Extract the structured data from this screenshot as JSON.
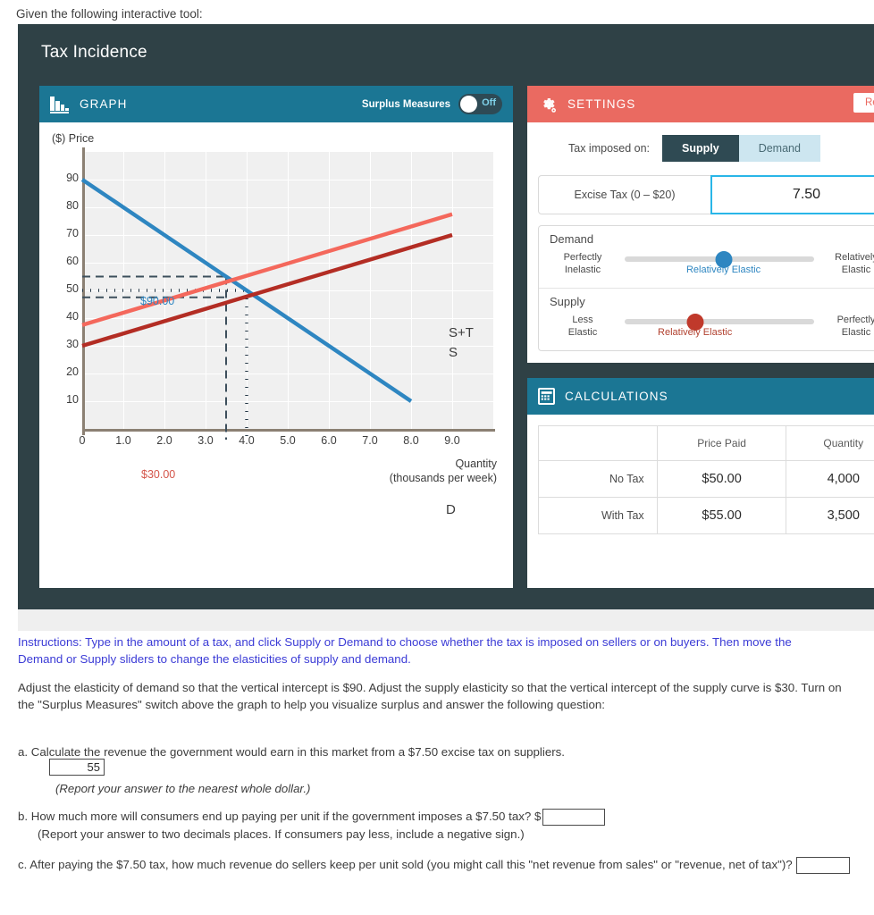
{
  "intro": "Given the following interactive tool:",
  "tool": {
    "title": "Tax Incidence",
    "graph_panel": {
      "header_label": "GRAPH",
      "icon": "bar-chart-icon",
      "switch": {
        "label": "Surplus Measures",
        "state": "Off"
      }
    },
    "settings_panel": {
      "header_label": "SETTINGS",
      "icon": "gear-icon",
      "reset_label": "Reset",
      "tax_imposed_on_label": "Tax imposed on:",
      "segments": [
        {
          "label": "Supply",
          "selected": true
        },
        {
          "label": "Demand",
          "selected": false
        }
      ],
      "excise": {
        "label": "Excise Tax (0 – $20)",
        "value": "7.50"
      },
      "demand": {
        "title": "Demand",
        "left_label": "Perfectly\nInelastic",
        "right_label": "Relatively\nElastic",
        "caption": "Relatively Elastic",
        "position_pct": 52,
        "color": "#2e86c1"
      },
      "supply": {
        "title": "Supply",
        "left_label": "Less\nElastic",
        "right_label": "Perfectly\nElastic",
        "caption": "Relatively Elastic",
        "position_pct": 38,
        "color": "#c0392b"
      }
    },
    "calculations_panel": {
      "header_label": "CALCULATIONS",
      "icon": "calculator-icon",
      "columns": [
        "",
        "Price Paid",
        "Quantity"
      ],
      "rows": [
        {
          "label": "No Tax",
          "price_paid": "$50.00",
          "quantity": "4,000"
        },
        {
          "label": "With Tax",
          "price_paid": "$55.00",
          "quantity": "3,500"
        }
      ]
    }
  },
  "chart_data": {
    "type": "line",
    "title": "",
    "ylabel": "($) Price",
    "xlabel": "Quantity\n(thousands per week)",
    "xlabel_line1": "Quantity",
    "xlabel_line2": "(thousands per week)",
    "xlim": [
      0,
      10
    ],
    "ylim": [
      0,
      100
    ],
    "yticks": [
      90,
      80,
      70,
      60,
      50,
      40,
      30,
      20,
      10
    ],
    "xticks": [
      "0",
      "1.0",
      "2.0",
      "3.0",
      "4.0",
      "5.0",
      "6.0",
      "7.0",
      "8.0",
      "9.0"
    ],
    "grid": true,
    "legend": "inline-labels",
    "series": [
      {
        "name": "D",
        "label": "D",
        "color": "#2e86c1",
        "points": [
          [
            0,
            90
          ],
          [
            8,
            10
          ]
        ],
        "annotation": "$90.00",
        "annotation_value": 90
      },
      {
        "name": "S",
        "label": "S",
        "color": "#b32d24",
        "points": [
          [
            0,
            30
          ],
          [
            9,
            70
          ]
        ],
        "annotation": "$30.00",
        "annotation_value": 30
      },
      {
        "name": "S+T",
        "label": "S+T",
        "color": "#f4685c",
        "points": [
          [
            0,
            37.5
          ],
          [
            9,
            77.5
          ]
        ]
      }
    ],
    "markers": {
      "dotted_equilibrium": {
        "price": 50,
        "quantity": 4.0,
        "style": "dotted"
      },
      "dashed_with_tax_buyer": {
        "price": 55,
        "quantity": 3.5,
        "style": "dashed"
      },
      "dashed_with_tax_seller": {
        "price": 47.5,
        "quantity": 3.5,
        "style": "dashed"
      }
    }
  },
  "body": {
    "instructions": "Instructions: Type in the amount of a tax, and click Supply or Demand to choose whether the tax is imposed on sellers or on buyers.  Then move the Demand or Supply sliders to change the elasticities of supply and demand.",
    "paragraph": "Adjust the elasticity of demand so that the vertical intercept is $90.  Adjust the supply elasticity so that the vertical intercept of the supply curve is $30.  Turn on the \"Surplus Measures\" switch above the graph to help you visualize surplus and answer the following question:",
    "question_a": "a. Calculate the revenue the government would earn in this market from a $7.50 excise tax on suppliers.",
    "answer_a": "55",
    "note_a": "(Report your answer to the nearest whole dollar.)",
    "question_b_main": "b. How much more will consumers end up paying per unit if the government imposes a $7.50 tax?",
    "question_b_dollar": "$",
    "answer_b": "",
    "note_b": "(Report your answer to two decimals places.  If consumers pay less, include a negative sign.)",
    "question_c": "c. After paying the $7.50 tax, how much revenue do sellers keep per unit sold (you might call this \"net revenue from sales\" or \"revenue, net of tax\")?",
    "answer_c": ""
  },
  "colors": {
    "tool_bg": "#2f4146",
    "teal_header": "#1b7694",
    "red_header": "#ea6a61",
    "demand_blue": "#2e86c1",
    "supply_red": "#b32d24",
    "supply_tax": "#f4685c",
    "instructions_blue": "#3b3bd6"
  }
}
